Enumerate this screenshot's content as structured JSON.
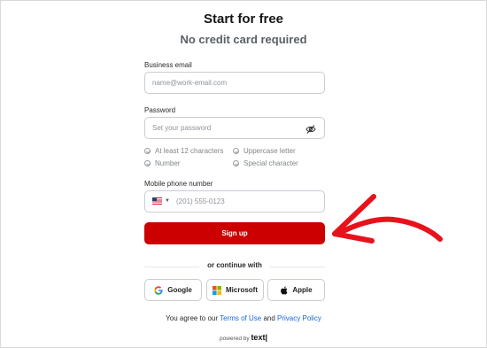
{
  "header": {
    "title": "Start for free",
    "subtitle": "No credit card required"
  },
  "email": {
    "label": "Business email",
    "placeholder": "name@work-email.com"
  },
  "password": {
    "label": "Password",
    "placeholder": "Set your password",
    "toggle_icon": "eye-slash-icon"
  },
  "requirements": [
    {
      "text": "At least 12 characters",
      "met": false
    },
    {
      "text": "Uppercase letter",
      "met": false
    },
    {
      "text": "Number",
      "met": false
    },
    {
      "text": "Special character",
      "met": false
    }
  ],
  "phone": {
    "label": "Mobile phone number",
    "country_icon": "us-flag-icon",
    "placeholder": "(201) 555-0123"
  },
  "signup": {
    "label": "Sign up",
    "color": "#cc0000"
  },
  "divider_text": "or continue with",
  "sso": {
    "google": "Google",
    "microsoft": "Microsoft",
    "apple": "Apple"
  },
  "agreement": {
    "prefix": "You agree to our ",
    "terms": "Terms of Use",
    "middle": " and ",
    "privacy": "Privacy Policy"
  },
  "footer": {
    "powered_by": "powered by ",
    "brand": "text|"
  },
  "annotation": {
    "icon": "red-hand-drawn-arrow-icon",
    "color": "#e8121c"
  }
}
